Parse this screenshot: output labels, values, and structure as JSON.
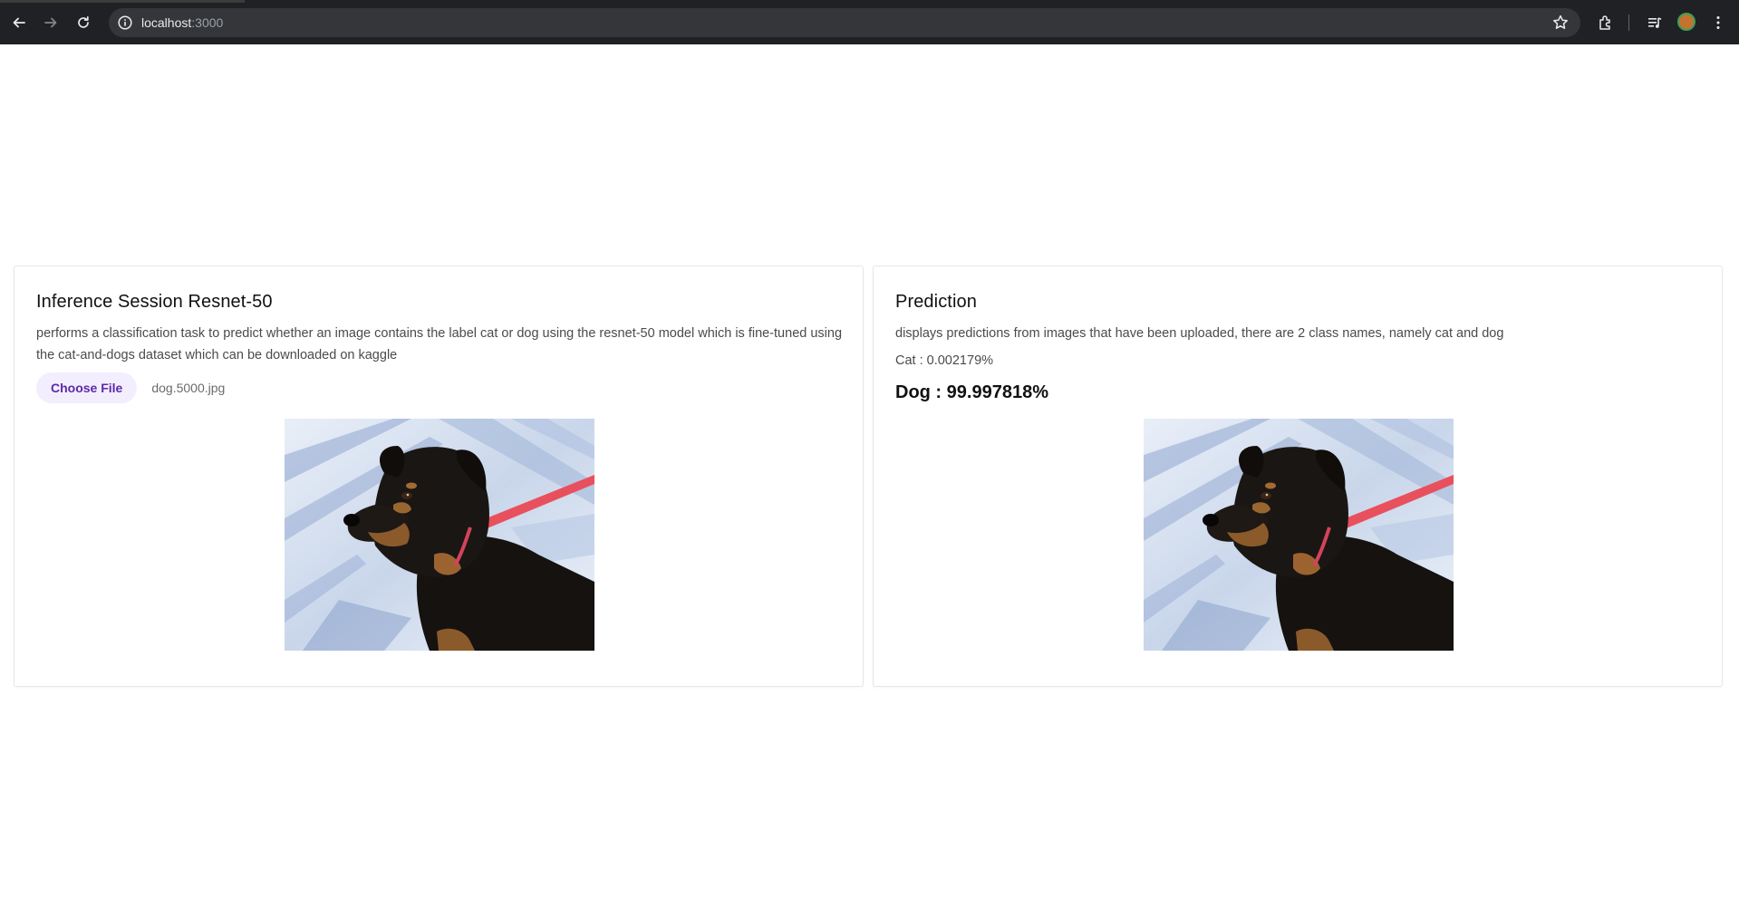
{
  "browser": {
    "url_host": "localhost",
    "url_port": ":3000"
  },
  "upload_card": {
    "title": "Inference Session Resnet-50",
    "description": "performs a classification task to predict whether an image contains the label cat or dog using the resnet-50 model which is fine-tuned using the cat-and-dogs dataset which can be downloaded on kaggle",
    "choose_file_label": "Choose File",
    "file_name": "dog.5000.jpg"
  },
  "prediction_card": {
    "title": "Prediction",
    "description": "displays predictions from images that have been uploaded, there are 2 class names, namely cat and dog",
    "cat_result": "Cat : 0.002179%",
    "dog_result": "Dog : 99.997818%"
  },
  "colors": {
    "accent_button_bg": "#f3eefe",
    "accent_button_text": "#5b2aa8",
    "chrome_bg": "#202124",
    "omnibox_bg": "#35363a"
  },
  "icons": [
    "back-arrow-icon",
    "forward-arrow-icon",
    "reload-icon",
    "site-info-icon",
    "bookmark-star-icon",
    "extensions-icon",
    "media-controls-icon",
    "profile-avatar-icon",
    "more-menu-icon"
  ]
}
